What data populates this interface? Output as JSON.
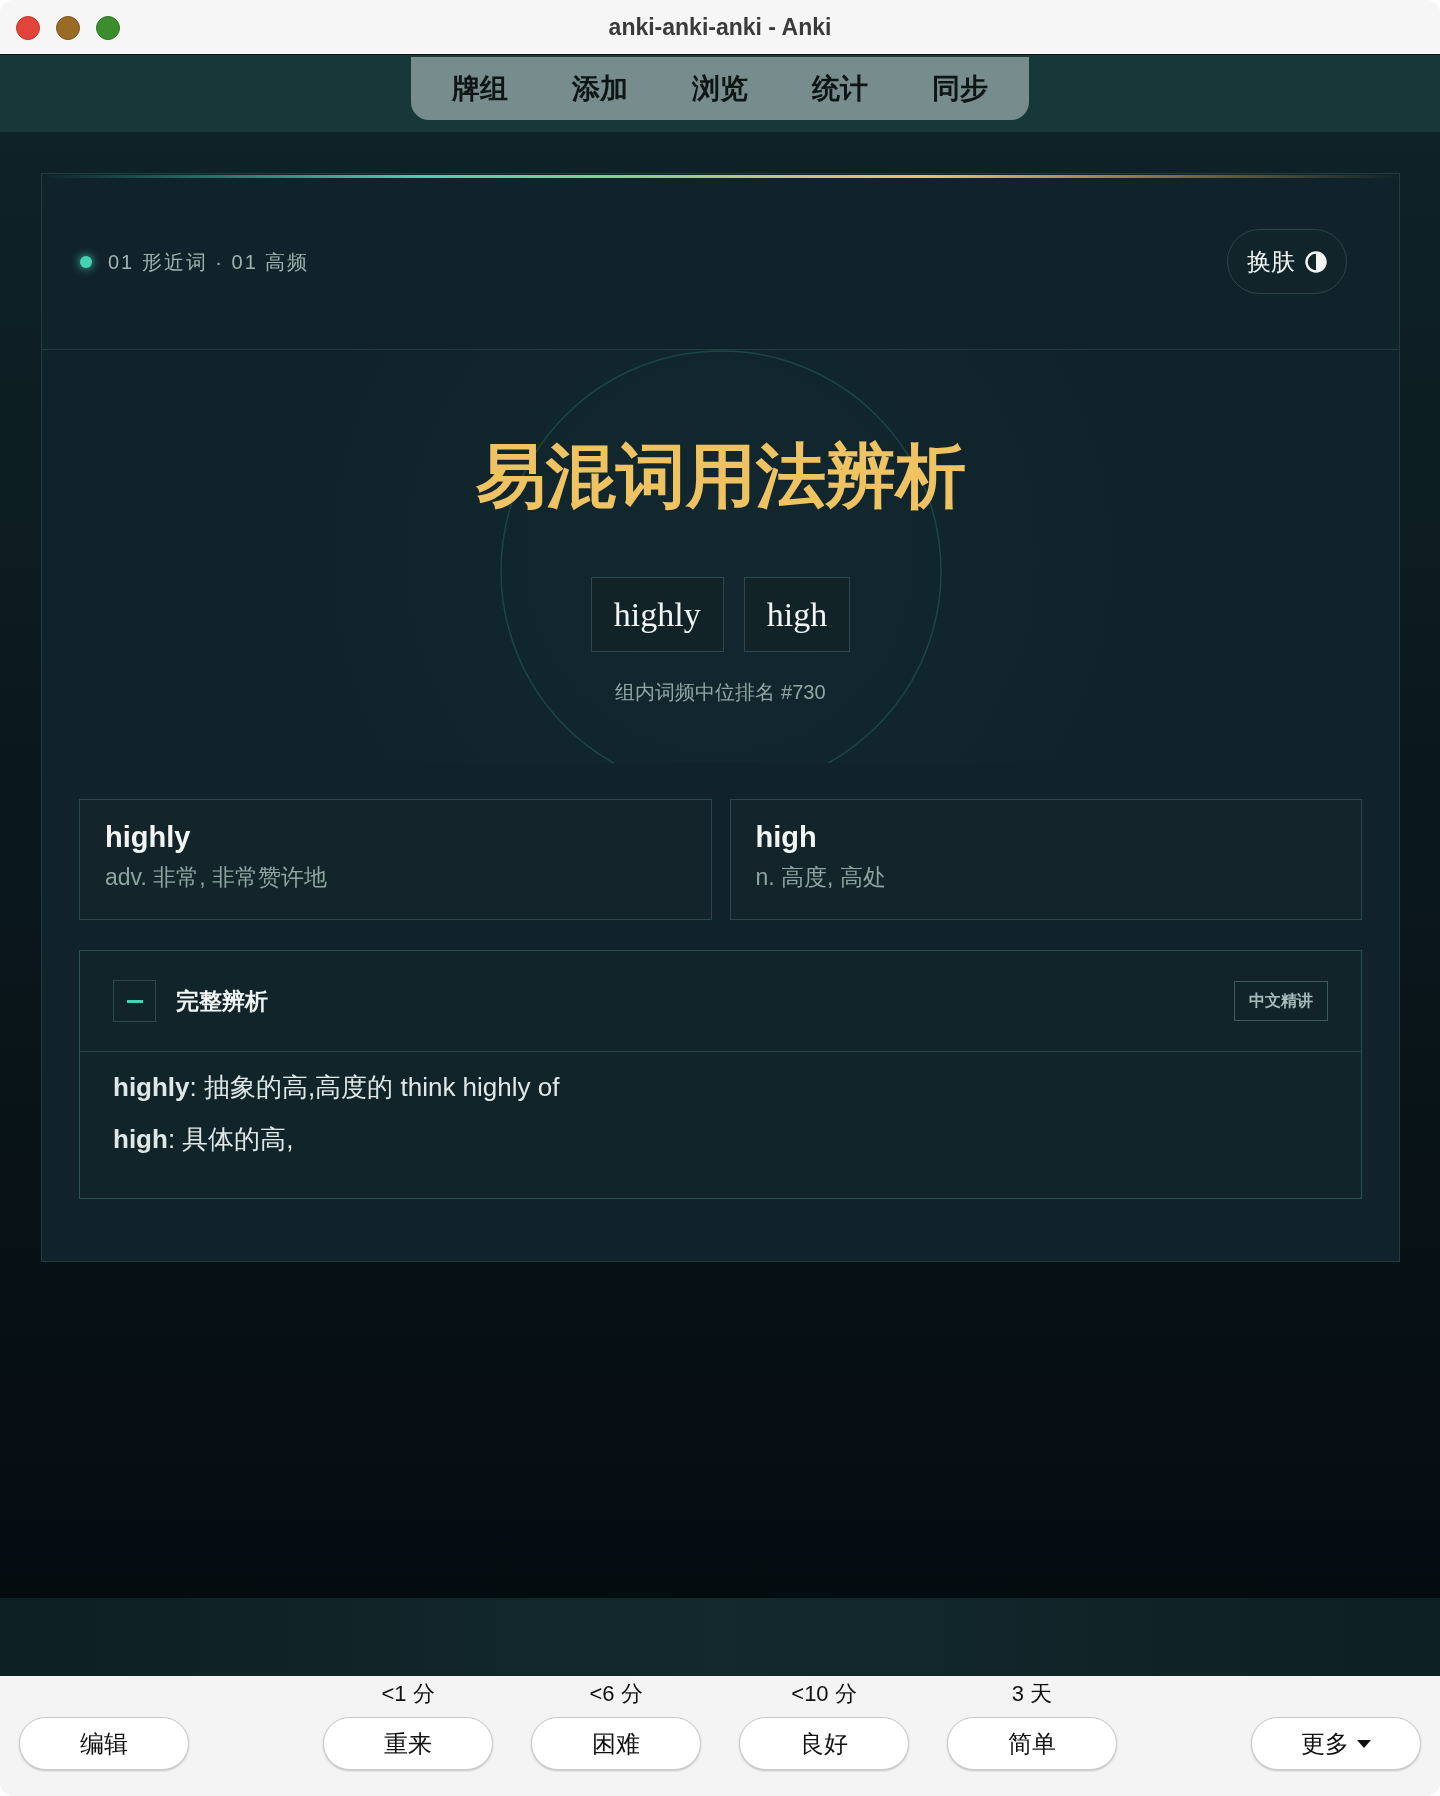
{
  "window": {
    "title": "anki-anki-anki - Anki"
  },
  "toolbar": {
    "items": [
      "牌组",
      "添加",
      "浏览",
      "统计",
      "同步"
    ]
  },
  "card": {
    "breadcrumb": "01 形近词 · 01 高频",
    "skin_button": "换肤",
    "title": "易混词用法辨析",
    "words": [
      "highly",
      "high"
    ],
    "rank": "组内词频中位排名 #730",
    "definitions": [
      {
        "word": "highly",
        "meaning": "adv. 非常, 非常赞许地"
      },
      {
        "word": "high",
        "meaning": "n. 高度, 高处"
      }
    ],
    "analysis": {
      "title": "完整辨析",
      "expanded": true,
      "badge": "中文精讲",
      "lines": [
        "**highly**: 抽象的高,高度的 think highly of",
        "**high**: 具体的高,"
      ]
    }
  },
  "answer_bar": {
    "edit_button": "编辑",
    "ease_buttons": [
      {
        "interval": "<1 分",
        "label": "重来"
      },
      {
        "interval": "<6 分",
        "label": "困难"
      },
      {
        "interval": "<10 分",
        "label": "良好"
      },
      {
        "interval": "3 天",
        "label": "简单"
      }
    ],
    "more_button": "更多"
  }
}
